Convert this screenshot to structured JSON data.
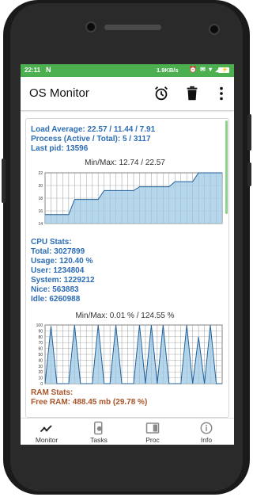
{
  "statusbar": {
    "time": "22:11",
    "carrier_icon": "N",
    "speed": "1.9KB/s",
    "icons": "⏰ ✉ ▾ ◢"
  },
  "app": {
    "title": "OS Monitor",
    "actions": [
      "alarm-icon",
      "delete-icon",
      "more-vert-icon"
    ]
  },
  "load": {
    "load_average": "Load Average: 22.57 / 11.44 / 7.91",
    "process": "Process (Active / Total): 5 / 3117",
    "last_pid": "Last pid: 13596"
  },
  "cpu": {
    "header": "CPU Stats:",
    "total": "Total: 3027899",
    "usage": "Usage: 120.40 %",
    "user": "User: 1234804",
    "system": "System: 1229212",
    "nice": "Nice: 563883",
    "idle": "Idle: 6260988"
  },
  "ram": {
    "header": "RAM Stats:",
    "partial": "Free RAM: 488.45 mb (29.78 %)"
  },
  "nav": {
    "items": [
      {
        "label": "Monitor",
        "icon": "trend-icon"
      },
      {
        "label": "Tasks",
        "icon": "tasks-icon"
      },
      {
        "label": "Proc",
        "icon": "proc-icon"
      },
      {
        "label": "Info",
        "icon": "info-icon"
      }
    ]
  },
  "chart_data": [
    {
      "type": "area",
      "title": "Min/Max: 12.74 / 22.57",
      "ylim": [
        14,
        22
      ],
      "yticks": [
        "14",
        "16",
        "18",
        "20",
        "22"
      ],
      "values": [
        15.4,
        15.4,
        15.4,
        15.4,
        15.4,
        17.8,
        17.8,
        17.8,
        17.8,
        17.8,
        19.2,
        19.2,
        19.2,
        19.2,
        19.2,
        19.2,
        19.8,
        19.8,
        19.8,
        19.8,
        19.8,
        19.8,
        20.6,
        20.6,
        20.6,
        20.6,
        22.2,
        22.2,
        22.2,
        22.2,
        22.2
      ],
      "grid": true,
      "color": "#3d8fd1"
    },
    {
      "type": "area",
      "title": "Min/Max: 0.01 % / 124.55 %",
      "ylim": [
        0,
        100
      ],
      "yticks": [
        "0",
        "10",
        "20",
        "30",
        "40",
        "50",
        "60",
        "70",
        "80",
        "90",
        "100"
      ],
      "values": [
        0,
        98,
        0,
        0,
        0,
        100,
        0,
        0,
        0,
        100,
        0,
        0,
        100,
        0,
        0,
        0,
        100,
        0,
        100,
        0,
        100,
        0,
        0,
        0,
        100,
        0,
        80,
        0,
        100,
        0,
        0
      ],
      "grid": true,
      "color": "#3d8fd1"
    }
  ]
}
